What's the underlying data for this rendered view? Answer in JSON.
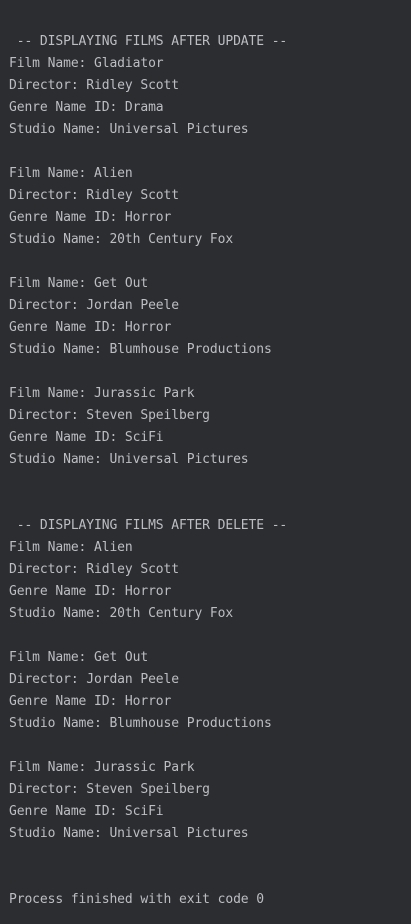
{
  "console": {
    "lines": [
      " -- DISPLAYING FILMS AFTER UPDATE --",
      "Film Name: Gladiator",
      "Director: Ridley Scott",
      "Genre Name ID: Drama",
      "Studio Name: Universal Pictures",
      "",
      "Film Name: Alien",
      "Director: Ridley Scott",
      "Genre Name ID: Horror",
      "Studio Name: 20th Century Fox",
      "",
      "Film Name: Get Out",
      "Director: Jordan Peele",
      "Genre Name ID: Horror",
      "Studio Name: Blumhouse Productions",
      "",
      "Film Name: Jurassic Park",
      "Director: Steven Speilberg",
      "Genre Name ID: SciFi",
      "Studio Name: Universal Pictures",
      "",
      "",
      " -- DISPLAYING FILMS AFTER DELETE --",
      "Film Name: Alien",
      "Director: Ridley Scott",
      "Genre Name ID: Horror",
      "Studio Name: 20th Century Fox",
      "",
      "Film Name: Get Out",
      "Director: Jordan Peele",
      "Genre Name ID: Horror",
      "Studio Name: Blumhouse Productions",
      "",
      "Film Name: Jurassic Park",
      "Director: Steven Speilberg",
      "Genre Name ID: SciFi",
      "Studio Name: Universal Pictures",
      "",
      "",
      "Process finished with exit code 0"
    ]
  }
}
